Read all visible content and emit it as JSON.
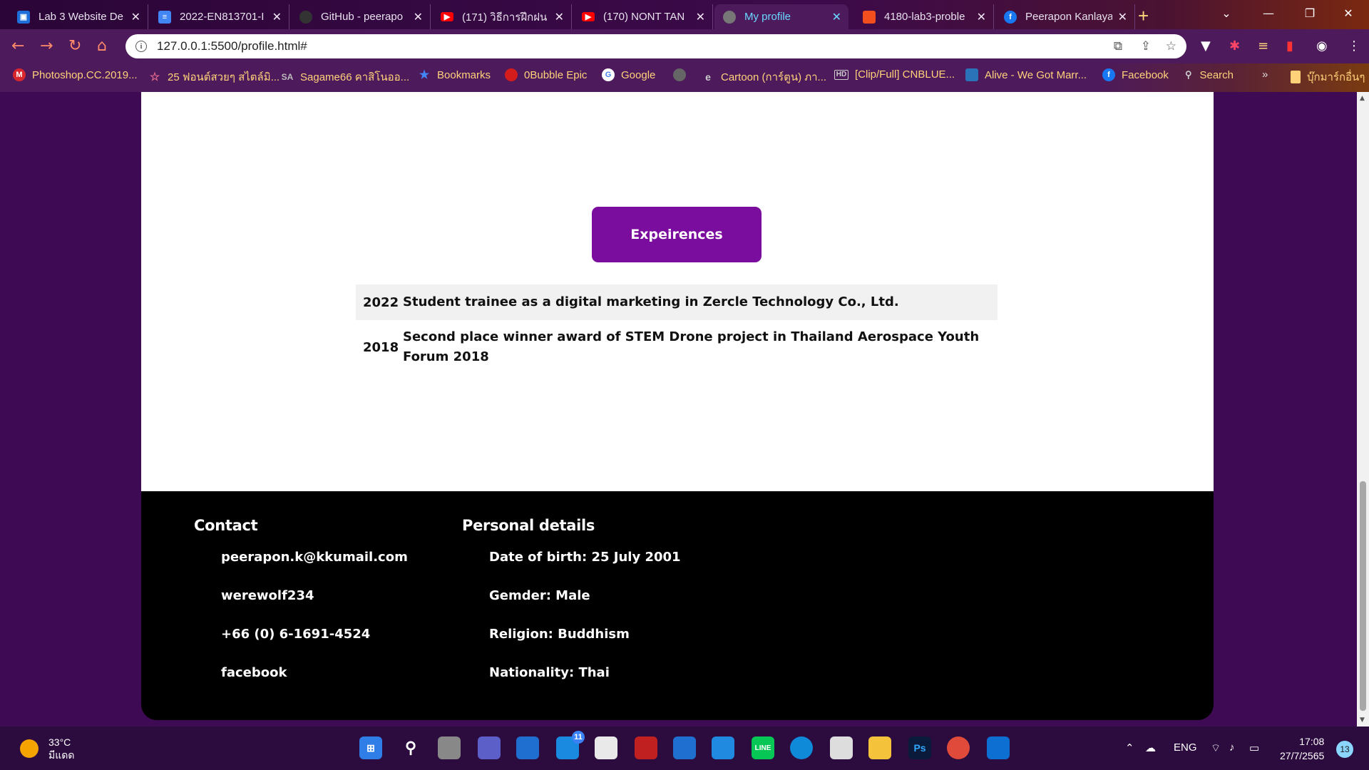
{
  "browser": {
    "tabs": [
      {
        "title": "Lab 3 Website De",
        "icon": "google-classroom-icon",
        "color": "#1e8e3e"
      },
      {
        "title": "2022-EN813701-I",
        "icon": "google-docs-icon",
        "color": "#4285f4"
      },
      {
        "title": "GitHub - peerapo",
        "icon": "github-icon",
        "color": "#333333"
      },
      {
        "title": "(171) วิธีการฝึกฝน",
        "icon": "youtube-icon",
        "color": "#ff0000"
      },
      {
        "title": "(170) NONT TAN",
        "icon": "youtube-icon",
        "color": "#ff0000"
      },
      {
        "title": "My profile",
        "icon": "globe-icon",
        "color": "#777777",
        "active": true
      },
      {
        "title": "4180-lab3-proble",
        "icon": "figma-icon",
        "color": "#f24e1e"
      },
      {
        "title": "Peerapon Kanlaya",
        "icon": "facebook-icon",
        "color": "#1877f2"
      }
    ],
    "new_tab": "+",
    "address": "127.0.0.1:5500/profile.html#",
    "bookmarks": [
      {
        "label": "Photoshop.CC.2019...",
        "icon": "mega-icon",
        "color": "#d9272e"
      },
      {
        "label": "25 ฟอนต์สวยๆ สไตล์มิ...",
        "icon": "star-icon",
        "color": "#e26a8c"
      },
      {
        "label": "Sagame66 คาสิโนออ...",
        "icon": "sa-icon",
        "color": "#777777"
      },
      {
        "label": "Bookmarks",
        "icon": "star-icon",
        "color": "#4285f4"
      },
      {
        "label": "0Bubble Epic",
        "icon": "bubble-icon",
        "color": "#d51c1c"
      },
      {
        "label": "Google",
        "icon": "google-icon",
        "color": "#ffffff"
      },
      {
        "label": "",
        "icon": "globe-icon",
        "color": "#888888"
      },
      {
        "label": "Cartoon (การ์ตูน) ภา...",
        "icon": "e-icon",
        "color": "#888888"
      },
      {
        "label": "[Clip/Full] CNBLUE...",
        "icon": "hd-icon",
        "color": "#999999"
      },
      {
        "label": "Alive - We Got Marr...",
        "icon": "site-icon",
        "color": "#2a73b8"
      },
      {
        "label": "Facebook",
        "icon": "facebook-icon",
        "color": "#1877f2"
      },
      {
        "label": "Search",
        "icon": "search-icon",
        "color": "#aaaaaa"
      }
    ],
    "bookmarks_overflow": "»",
    "other_bookmarks": "บุ๊กมาร์กอื่นๆ"
  },
  "page": {
    "experiences_button": "Expeirences",
    "experiences": [
      {
        "year": "2022",
        "description": "Student trainee as a digital marketing in Zercle Technology Co., Ltd."
      },
      {
        "year": "2018",
        "description": "Second place winner award of STEM Drone project in Thailand Aerospace Youth Forum 2018"
      }
    ],
    "footer": {
      "contact_title": "Contact",
      "contact": [
        "peerapon.k@kkumail.com",
        "werewolf234",
        "+66 (0) 6-1691-4524",
        "facebook"
      ],
      "personal_title": "Personal details",
      "personal": [
        "Date of birth: 25 July 2001",
        "Gemder: Male",
        "Religion: Buddhism",
        "Nationality: Thai"
      ]
    }
  },
  "taskbar": {
    "temperature": "33°C",
    "weather": "มีแดด",
    "notifications_badge": "11",
    "language": "ENG",
    "time": "17:08",
    "date": "27/7/2565",
    "notification_count": "13"
  }
}
